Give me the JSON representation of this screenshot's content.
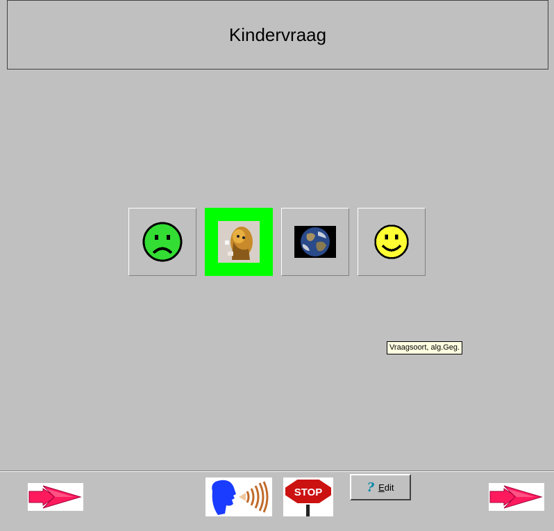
{
  "title": "Kindervraag",
  "choices": [
    {
      "icon": "sad-face-icon",
      "selected": false
    },
    {
      "icon": "portrait-image-icon",
      "selected": true
    },
    {
      "icon": "globe-icon",
      "selected": false
    },
    {
      "icon": "happy-face-icon",
      "selected": false
    }
  ],
  "tooltip": "Vraagsoort, alg.Geg.",
  "toolbar": {
    "edit_label_mnemonic": "E",
    "edit_label_rest": "dit",
    "edit_icon": "question-mark-icon",
    "stop_sign_text": "STOP",
    "prev_icon": "arrow-right-icon",
    "next_icon": "arrow-right-icon",
    "speak_icon": "speaking-head-icon"
  },
  "colors": {
    "background": "#c0c0c0",
    "selected_highlight": "#00ff00",
    "tooltip_bg": "#ffffe1",
    "sad_face": "#33dd33",
    "happy_face": "#ffff33",
    "arrow": "#ff1a5e",
    "stop_red": "#cc1111",
    "speaker_blue": "#1a3cff",
    "sound_waves": "#c06a2a"
  }
}
